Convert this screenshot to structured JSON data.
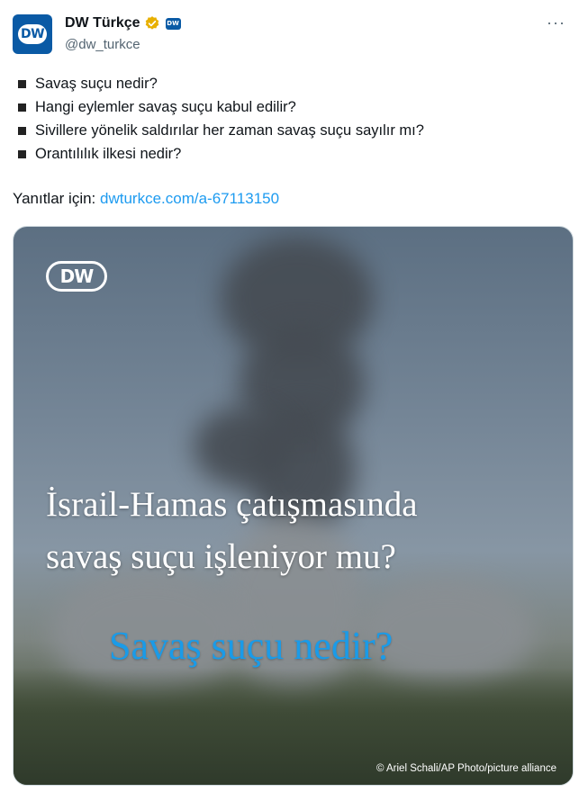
{
  "tweet": {
    "display_name": "DW Türkçe",
    "handle": "@dw_turkce",
    "avatar_text": "DW",
    "affiliate_badge_text": "DW",
    "verified_color": "#e8b000",
    "bullets": [
      "Savaş suçu nedir?",
      "Hangi eylemler savaş suçu kabul edilir?",
      "Sivillere yönelik saldırılar her zaman savaş suçu sayılır mı?",
      "Orantılılık ilkesi nedir?"
    ],
    "answers_label": "Yanıtlar için:",
    "answers_link": "dwturkce.com/a-67113150"
  },
  "media": {
    "logo_text": "DW",
    "headline_line1": "İsrail-Hamas çatışmasında",
    "headline_line2": "savaş suçu işleniyor mu?",
    "subheadline": "Savaş suçu nedir?",
    "subheadline_color": "#1a9be8",
    "credit": "© Ariel Schali/AP Photo/picture alliance"
  },
  "icons": [
    "verified-icon",
    "more-icon",
    "bullet-icon"
  ]
}
